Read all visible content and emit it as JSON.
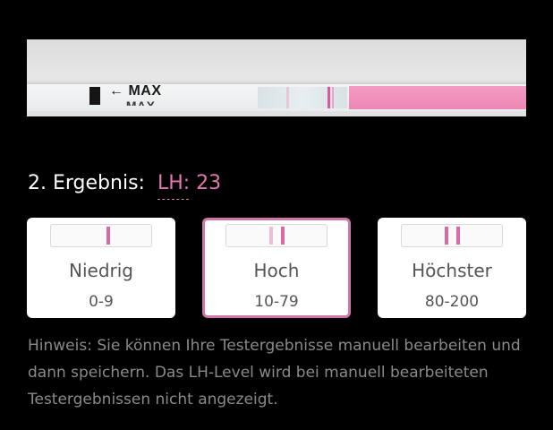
{
  "strip_photo": {
    "arrow_label": "← MAX",
    "arrow_label_reflection": "← MAX"
  },
  "result": {
    "heading": "2. Ergebnis:",
    "lh_value": "LH: 23"
  },
  "levels": [
    {
      "label": "Niedrig",
      "range": "0-9",
      "selected": false
    },
    {
      "label": "Hoch",
      "range": "10-79",
      "selected": true
    },
    {
      "label": "Höchster",
      "range": "80-200",
      "selected": false
    }
  ],
  "hint": "Hinweis: Sie können Ihre Testergebnisse manuell bearbeiten und dann speichern. Das LH-Level wird bei manuell bearbeiteten Testergebnissen nicht angezeigt.",
  "colors": {
    "accent": "#d176a8",
    "lh_text": "#e077b0",
    "hint_text": "#8a8a8a",
    "background": "#000000"
  }
}
